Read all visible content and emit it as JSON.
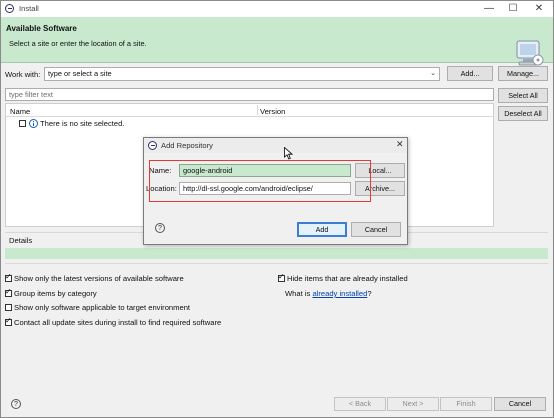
{
  "window": {
    "title": "Install"
  },
  "banner": {
    "heading": "Available Software",
    "subtitle": "Select a site or enter the location of a site."
  },
  "work_with": {
    "label": "Work with:",
    "value": "type or select a site",
    "add_label": "Add...",
    "manage_label": "Manage..."
  },
  "filter": {
    "placeholder": "type filter text"
  },
  "select_all_label": "Select All",
  "deselect_all_label": "Deselect All",
  "table": {
    "columns": [
      "Name",
      "Version"
    ],
    "empty_message": "There is no site selected."
  },
  "details": {
    "label": "Details"
  },
  "options": {
    "latest_versions": "Show only the latest versions of available software",
    "group_by_category": "Group items by category",
    "target_env": "Show only software applicable to target environment",
    "contact_sites": "Contact all update sites during install to find required software",
    "hide_installed": "Hide items that are already installed",
    "what_is": "What is ",
    "already_installed": "already installed",
    "question_mark": "?"
  },
  "footer": {
    "back": "< Back",
    "next": "Next >",
    "finish": "Finish",
    "cancel": "Cancel"
  },
  "dialog": {
    "title": "Add Repository",
    "name_label": "Name:",
    "name_value": "google-android",
    "location_label": "Location:",
    "location_value": "http://dl-ssl.google.com/android/eclipse/",
    "local_label": "Local...",
    "archive_label": "Archive...",
    "add_label": "Add",
    "cancel_label": "Cancel"
  },
  "colors": {
    "banner_bg": "#c9e9cf",
    "highlight_input": "#c9e9cf",
    "annotation_red": "#e03a3a",
    "link": "#0645ad"
  }
}
